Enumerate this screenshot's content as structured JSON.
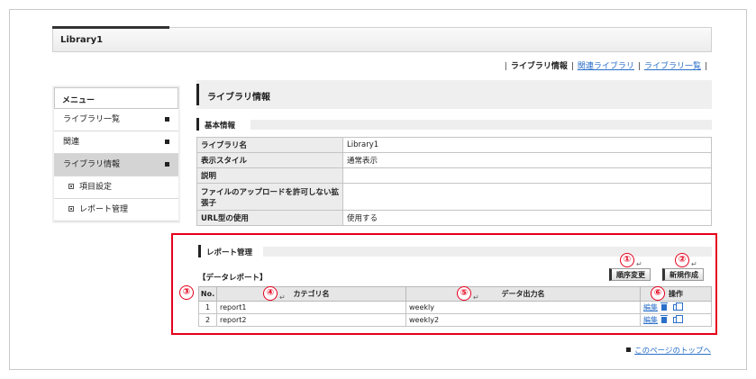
{
  "window": {
    "title": "Library1"
  },
  "topnav": {
    "current": "ライブラリ情報",
    "links": [
      "関連ライブラリ",
      "ライブラリ一覧"
    ]
  },
  "sidebar": {
    "header": "メニュー",
    "items": [
      {
        "label": "ライブラリ一覧"
      },
      {
        "label": "関連"
      },
      {
        "label": "ライブラリ情報"
      }
    ],
    "subitems": [
      {
        "label": "項目設定"
      },
      {
        "label": "レポート管理"
      }
    ]
  },
  "main": {
    "section_title": "ライブラリ情報",
    "basic_info_title": "基本情報",
    "info_rows": [
      {
        "key": "ライブラリ名",
        "value": "Library1"
      },
      {
        "key": "表示スタイル",
        "value": "通常表示"
      },
      {
        "key": "説明",
        "value": ""
      },
      {
        "key": "ファイルのアップロードを許可しない拡張子",
        "value": ""
      },
      {
        "key": "URL型の使用",
        "value": "使用する"
      }
    ],
    "report_title": "レポート管理",
    "data_report_label": "【データレポート】",
    "buttons": {
      "reorder": "順序変更",
      "create": "新規作成"
    },
    "report_table": {
      "headers": [
        "No.",
        "カテゴリ名",
        "データ出力名",
        "操作"
      ],
      "rows": [
        {
          "no": "1",
          "category": "report1",
          "output": "weekly",
          "edit": "編集"
        },
        {
          "no": "2",
          "category": "report2",
          "output": "weekly2",
          "edit": "編集"
        }
      ]
    }
  },
  "annotations": [
    "①",
    "②",
    "③",
    "④",
    "⑤",
    "⑥"
  ],
  "footer": {
    "page_top": "このページのトップへ"
  },
  "colors": {
    "highlight": "#e5001c",
    "link": "#2a6fc9"
  },
  "icons": [
    "trash-icon",
    "copy-icon",
    "return-arrow-icon"
  ]
}
